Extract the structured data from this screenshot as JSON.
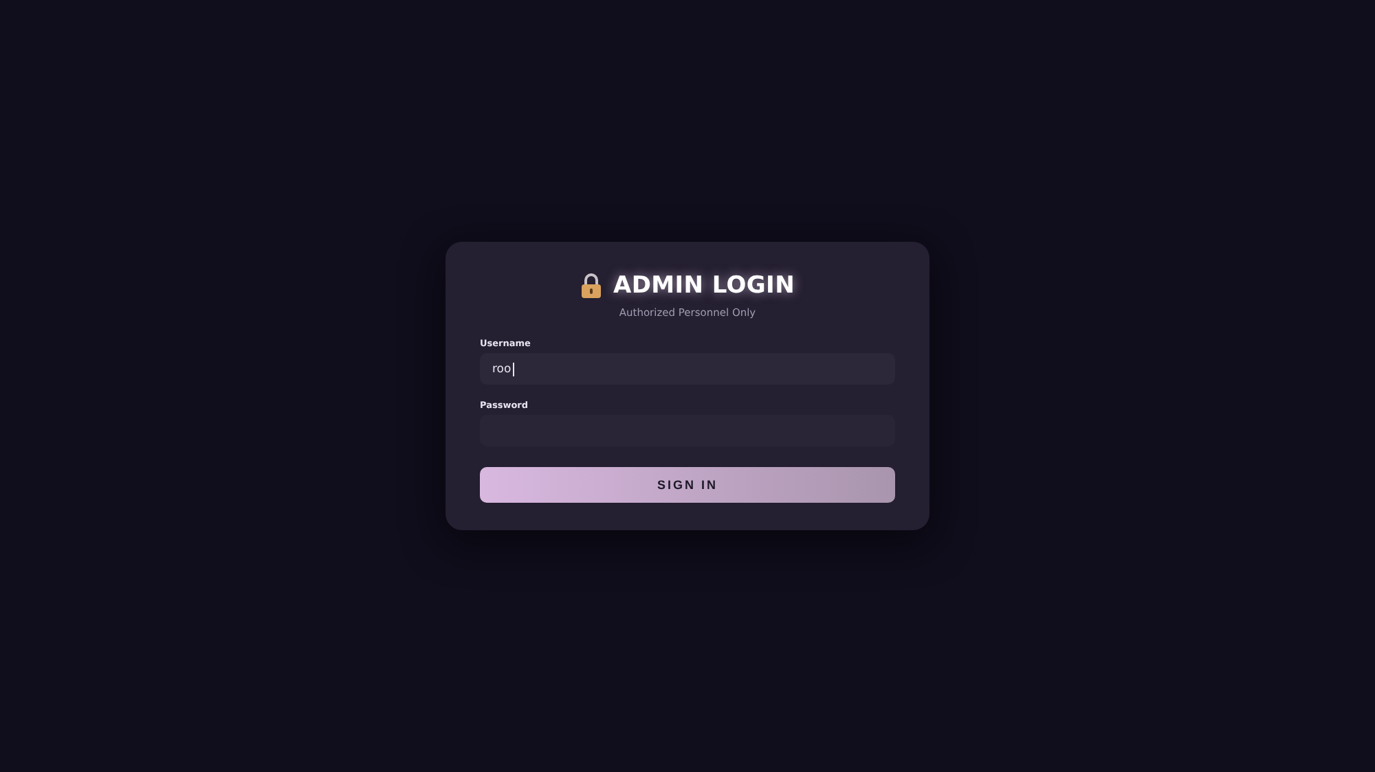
{
  "title": "ADMIN LOGIN",
  "subtitle": "Authorized Personnel Only",
  "fields": [
    {
      "label": "Username",
      "value": "roo",
      "focused": true
    },
    {
      "label": "Password",
      "focused": false
    }
  ],
  "button": "SIGN IN"
}
